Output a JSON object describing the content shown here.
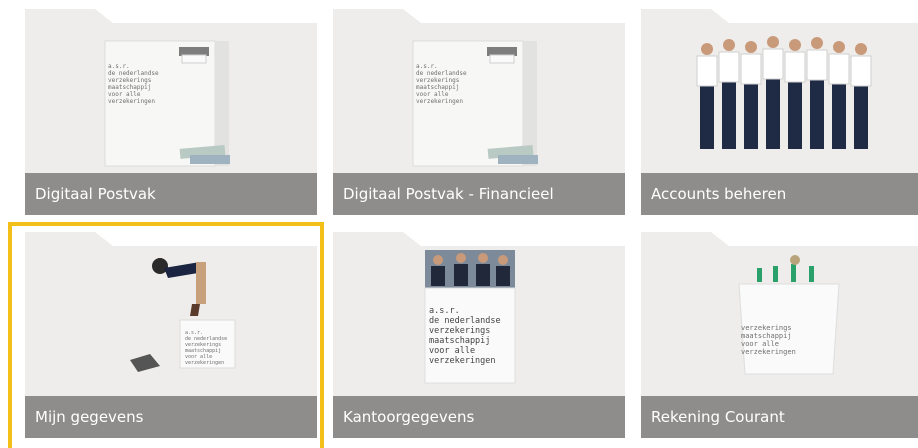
{
  "tiles": [
    {
      "label": "Digitaal Postvak"
    },
    {
      "label": "Digitaal Postvak - Financieel"
    },
    {
      "label": "Accounts beheren"
    },
    {
      "label": "Mijn gegevens"
    },
    {
      "label": "Kantoorgegevens"
    },
    {
      "label": "Rekening Courant"
    }
  ],
  "selected_tile": "Mijn gegevens",
  "box_text": "a.s.r.\nde nederlandse\nverzekerings\nmaatschappij\nvoor alle\nverzekeringen",
  "sign_text": "a.s.r.\nde nederlandse\nverzekerings\nmaatschappij\nvoor alle\nverzekeringen",
  "table_text": "verzekerings\nmaatschappij\nvoor alle\nverzekeringen",
  "colors": {
    "caption_bg": "#8f8d8b",
    "tile_bg": "#eeedeb",
    "selected_border": "#f3bf19"
  }
}
